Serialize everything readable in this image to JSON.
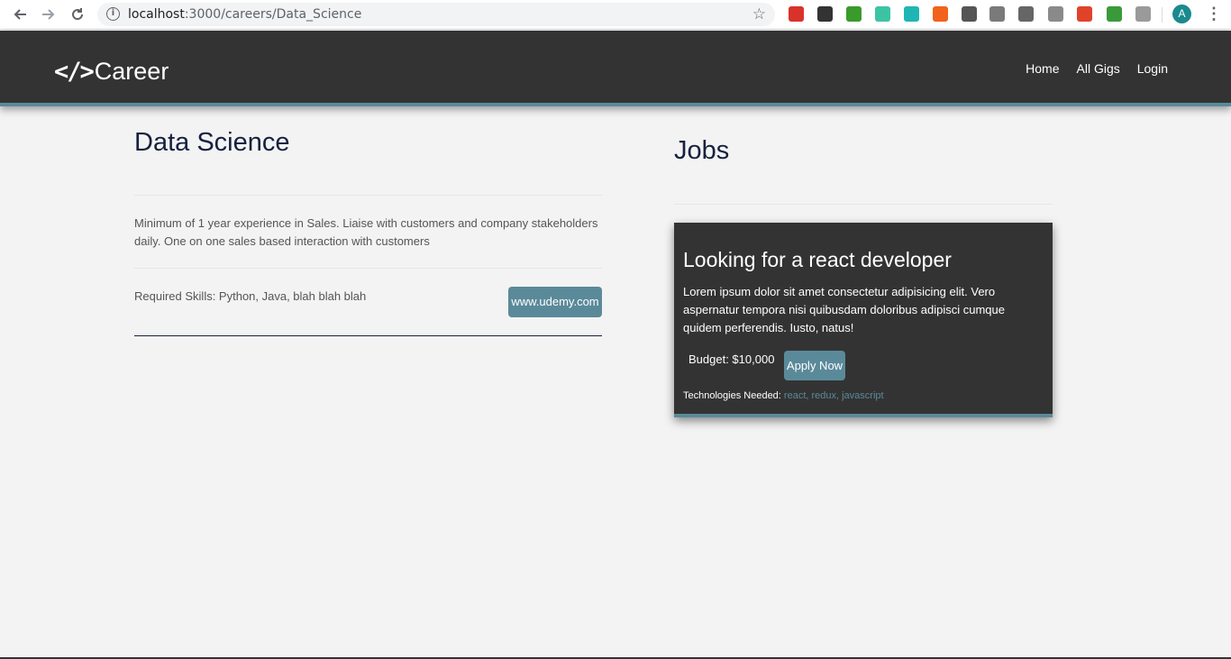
{
  "browser": {
    "url_host": "localhost",
    "url_path": ":3000/careers/Data_Science",
    "back_icon": "arrow-left-icon",
    "forward_icon": "arrow-right-icon",
    "reload_icon": "reload-icon",
    "info_glyph": "i",
    "star_glyph": "☆",
    "profile_initial": "A",
    "extensions": [
      "#d9322a",
      "#333333",
      "#3a9a2b",
      "#3cc3a4",
      "#1fb5b5",
      "#f2621c",
      "#555555",
      "#7a7a7a",
      "#666666",
      "#8a8a8a",
      "#e0432a",
      "#3a9a3a",
      "#9a9a9a"
    ]
  },
  "navbar": {
    "brand_logo": "</>",
    "brand_text": "Career",
    "links": [
      "Home",
      "All Gigs",
      "Login"
    ]
  },
  "career": {
    "title": "Data Science",
    "description": "Minimum of 1 year experience in Sales. Liaise with customers and company stakeholders daily. One on one sales based interaction with customers",
    "skills": "Required Skills: Python, Java, blah blah blah",
    "link_label": "www.udemy.com"
  },
  "jobs": {
    "heading": "Jobs",
    "card": {
      "title": "Looking for a react developer",
      "description": "Lorem ipsum dolor sit amet consectetur adipisicing elit. Vero aspernatur tempora nisi quibusdam doloribus adipisci cumque quidem perferendis. Iusto, natus!",
      "budget": "Budget: $10,000",
      "apply_label": "Apply Now",
      "tech_label": "Technologies Needed:",
      "tech_tags": "react, redux, javascript"
    }
  },
  "colors": {
    "navbar_bg": "#333333",
    "accent": "#5a8a99",
    "page_bg": "#f3f3f3",
    "heading": "#16213e"
  }
}
